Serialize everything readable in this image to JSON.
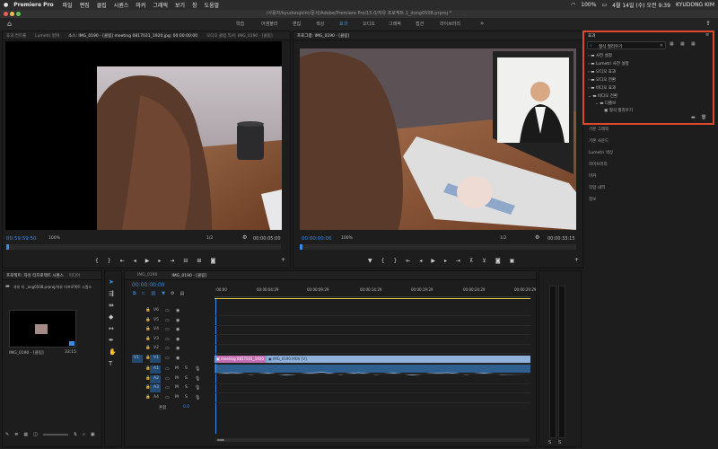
{
  "menubar": {
    "app": "Premiere Pro",
    "items": [
      "파일",
      "편집",
      "클립",
      "시퀀스",
      "마커",
      "그래픽",
      "보기",
      "창",
      "도움말"
    ],
    "battery": "100%",
    "datetime": "4월 14일 (수) 오전 9:39",
    "user": "KYUDONG KIM"
  },
  "titlebar": {
    "path": "/사용자/kyudongkim/문서/Adobe/Premiere Pro/15.0/자유 프로젝트 1_dong0508.prproj *"
  },
  "workspace": {
    "tabs": [
      "학습",
      "어셈블리",
      "편집",
      "색상",
      "효과",
      "오디오",
      "그래픽",
      "캡션",
      "라이브러리"
    ],
    "active": "효과"
  },
  "source_monitor": {
    "tabs": [
      "효과 컨트롤",
      "Lumetri 범위",
      "소스: IMG_0190 - [클립] meeting 0817031_1920.jpg: 00:00:00:00",
      "오디오 클립 믹서: IMG_0190 - [클립]"
    ],
    "timecode": "00:59:59:50",
    "zoom": "100%",
    "ratio": "1/2",
    "duration": "00:00:05:00"
  },
  "program_monitor": {
    "tab": "프로그램: IMG_0190 - [클립]",
    "timecode": "00:00:00:00",
    "zoom": "100%",
    "ratio": "1/2",
    "duration": "00:00:33:15"
  },
  "project_panel": {
    "tabs": [
      "프로젝트: 자유 티프로젝트 시퀀스",
      "미디어"
    ],
    "path": "자유 티 _ong0508.prproj/자유 티프로젝트 시퀀스",
    "clip_name": "IMG_0190 - [클립]",
    "clip_duration": "33:15"
  },
  "timeline": {
    "tabs": [
      "IMG_0190",
      "IMG_0190 - [클립]"
    ],
    "timecode": "00:00:00:00",
    "ruler": [
      ":00:00",
      "00:00:04:29",
      "00:00:09:29",
      "00:00:14:29",
      "00:00:19:29",
      "00:00:24:29",
      "00:00:29:29"
    ],
    "video_tracks": [
      "V6",
      "V5",
      "V4",
      "V3",
      "V2",
      "V1"
    ],
    "audio_tracks": [
      "A1",
      "A2",
      "A3",
      "A4"
    ],
    "mix_label": "혼합",
    "mix_value": "0.0",
    "clip_v1a": "meeting 0817031_1920",
    "clip_v1b": "IMG_0190.MOV [V]"
  },
  "effects_panel": {
    "title": "효과",
    "search_placeholder": "형식 질리우기",
    "folders": [
      "사전 설정",
      "Lumetri 사전 설정",
      "오디오 효과",
      "오디오 전환",
      "비디오 효과",
      "비디오 전환"
    ],
    "subfolder": "디졸브",
    "item": "형식 질리우기"
  },
  "side_panels": [
    "기본 그래픽",
    "기본 사운드",
    "Lumetri 색상",
    "라이브러리",
    "마커",
    "작업 내역",
    "정보"
  ],
  "colors": {
    "accent": "#3b8ce8",
    "highlight": "#e0472f",
    "clip_pink": "#c56db3",
    "clip_blue": "#7fa7d6"
  }
}
